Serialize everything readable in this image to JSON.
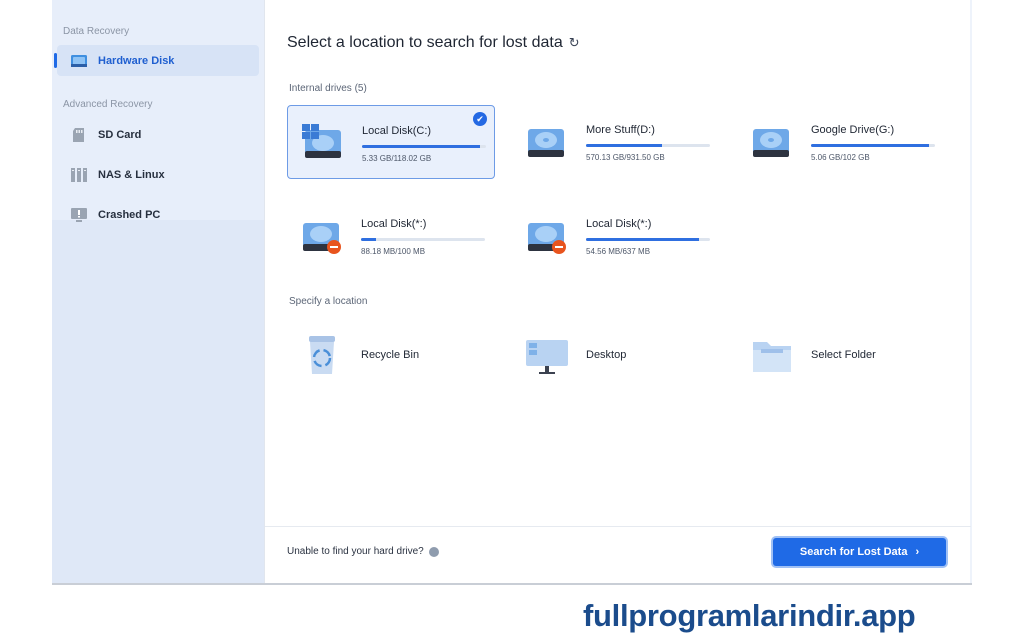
{
  "sidebar": {
    "section_data_recovery": "Data Recovery",
    "section_advanced": "Advanced Recovery",
    "items": [
      {
        "label": "Hardware Disk",
        "icon": "hard-disk-icon"
      },
      {
        "label": "SD Card",
        "icon": "sd-card-icon"
      },
      {
        "label": "NAS & Linux",
        "icon": "nas-icon"
      },
      {
        "label": "Crashed PC",
        "icon": "crashed-pc-icon"
      }
    ]
  },
  "main": {
    "title": "Select a location to search for lost data",
    "refresh_icon": "↻",
    "internal_label": "Internal drives (5)",
    "drives": [
      {
        "name": "Local Disk(C:)",
        "size": "5.33 GB/118.02 GB",
        "used_fraction": 0.95,
        "selected": true,
        "icon": "windows-drive-icon"
      },
      {
        "name": "More Stuff(D:)",
        "size": "570.13 GB/931.50 GB",
        "used_fraction": 0.61,
        "selected": false,
        "icon": "hard-drive-icon"
      },
      {
        "name": "Google Drive(G:)",
        "size": "5.06 GB/102 GB",
        "used_fraction": 0.95,
        "selected": false,
        "icon": "hard-drive-icon"
      },
      {
        "name": "Local Disk(*:)",
        "size": "88.18 MB/100 MB",
        "used_fraction": 0.12,
        "selected": false,
        "icon": "hard-drive-error-icon"
      },
      {
        "name": "Local Disk(*:)",
        "size": "54.56 MB/637 MB",
        "used_fraction": 0.91,
        "selected": false,
        "icon": "hard-drive-error-icon"
      }
    ],
    "specify_label": "Specify a location",
    "locations": [
      {
        "name": "Recycle Bin",
        "icon": "recycle-bin-icon"
      },
      {
        "name": "Desktop",
        "icon": "desktop-icon"
      },
      {
        "name": "Select Folder",
        "icon": "folder-icon"
      }
    ],
    "footer_text": "Unable to find your hard drive?",
    "search_button": "Search for Lost Data",
    "search_chevron": "›"
  },
  "watermark": "fullprogramlarindir.app",
  "colors": {
    "accent": "#1f6ae6",
    "sidebar": "#e7eefa",
    "error": "#e8541e"
  }
}
